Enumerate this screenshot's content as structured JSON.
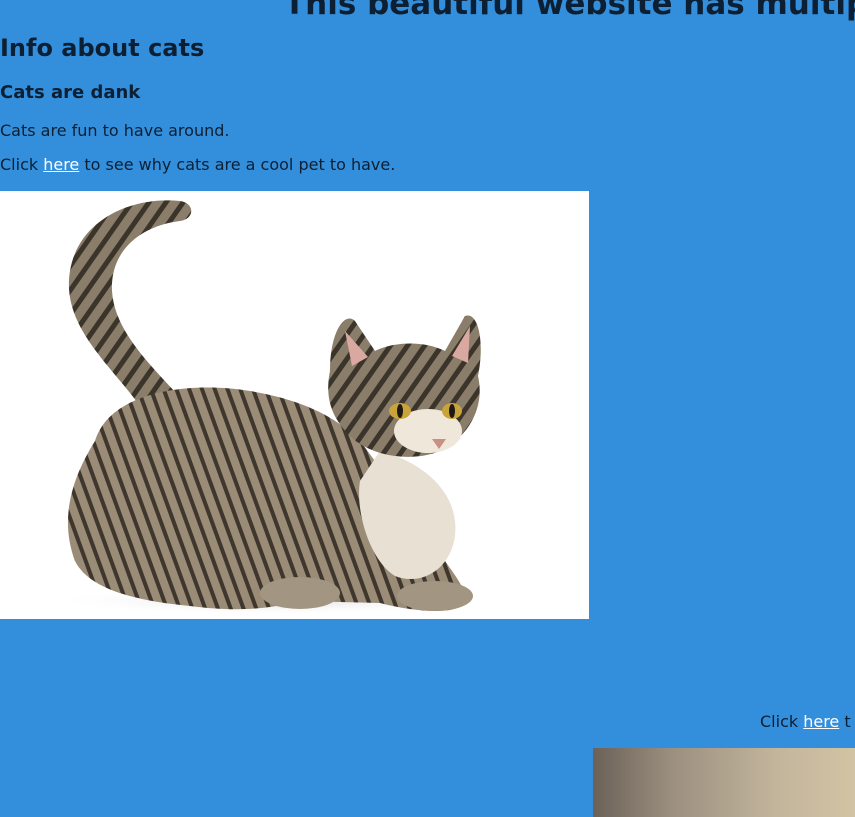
{
  "header": {
    "big_title": "This beautiful website has multiple"
  },
  "section1": {
    "heading": "Info about cats",
    "subheading": "Cats are dank",
    "paragraph": "Cats are fun to have around.",
    "click_prefix": "Click ",
    "link_label": "here",
    "click_suffix": " to see why cats are a cool pet to have."
  },
  "section2": {
    "click_prefix": "Click ",
    "link_label": "here",
    "click_suffix": " t"
  },
  "images": {
    "cat_photo": "tabby-cat-photo",
    "second_photo": "photo-partial"
  },
  "colors": {
    "page_background": "#338fdb",
    "text": "#0d1f33",
    "link": "#ffffff"
  }
}
